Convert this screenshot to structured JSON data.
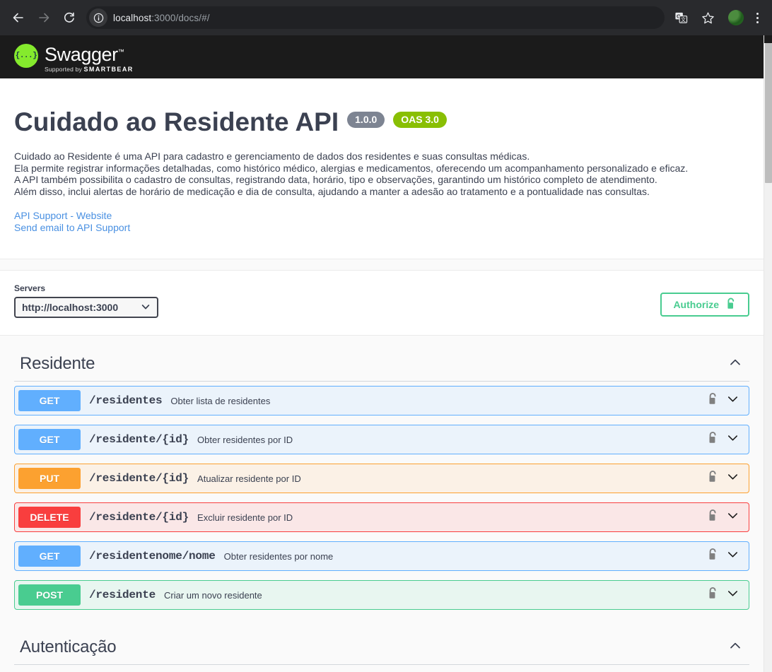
{
  "browser": {
    "back_icon": "arrow-left-icon",
    "forward_icon": "arrow-right-icon",
    "reload_icon": "reload-icon",
    "site_info_icon": "info-circle-icon",
    "url_host": "localhost",
    "url_path": ":3000/docs/#/",
    "url_full": "localhost:3000/docs/#/",
    "translate_icon": "translate-icon",
    "bookmark_icon": "star-icon",
    "profile_icon": "avatar",
    "menu_icon": "kebab-menu-icon"
  },
  "topbar": {
    "logo_glyph": "{...}",
    "logo_word": "Swagger",
    "logo_tm": "™",
    "supported_by_prefix": "Supported by",
    "supported_by_brand": "SMARTBEAR"
  },
  "info": {
    "title": "Cuidado ao Residente API",
    "version_badge": "1.0.0",
    "oas_badge": "OAS 3.0",
    "description_lines": [
      "Cuidado ao Residente é uma API para cadastro e gerenciamento de dados dos residentes e suas consultas médicas.",
      "Ela permite registrar informações detalhadas, como histórico médico, alergias e medicamentos, oferecendo um acompanhamento personalizado e eficaz.",
      "A API também possibilita o cadastro de consultas, registrando data, horário, tipo e observações, garantindo um histórico completo de atendimento.",
      "Além disso, inclui alertas de horário de medicação e dia de consulta, ajudando a manter a adesão ao tratamento e a pontualidade nas consultas."
    ],
    "links": [
      "API Support - Website",
      "Send email to API Support"
    ]
  },
  "scheme": {
    "servers_label": "Servers",
    "selected_server": "http://localhost:3000",
    "server_options": [
      "http://localhost:3000"
    ],
    "dropdown_icon": "chevron-down-icon",
    "authorize_label": "Authorize",
    "authorize_lock_icon": "unlocked-padlock-icon"
  },
  "colors": {
    "get": "#61affe",
    "put": "#fca130",
    "delete": "#f93e3e",
    "post": "#49cc90",
    "oas_badge": "#89bf04",
    "version_badge": "#7d8492",
    "authorize_green": "#49cc90",
    "link_blue": "#4990e2",
    "topbar_dark": "#1b1b1b",
    "swagger_green": "#85ea2d"
  },
  "tags": [
    {
      "name": "Residente",
      "collapse_icon": "chevron-up-icon",
      "operations": [
        {
          "verb": "GET",
          "path": "/residentes",
          "summary": "Obter lista de residentes",
          "lock_icon": "unlocked-padlock-icon",
          "expand_icon": "chevron-down-icon"
        },
        {
          "verb": "GET",
          "path": "/residente/{id}",
          "summary": "Obter residentes por ID",
          "lock_icon": "unlocked-padlock-icon",
          "expand_icon": "chevron-down-icon"
        },
        {
          "verb": "PUT",
          "path": "/residente/{id}",
          "summary": "Atualizar residente por ID",
          "lock_icon": "unlocked-padlock-icon",
          "expand_icon": "chevron-down-icon"
        },
        {
          "verb": "DELETE",
          "path": "/residente/{id}",
          "summary": "Excluir residente por ID",
          "lock_icon": "unlocked-padlock-icon",
          "expand_icon": "chevron-down-icon"
        },
        {
          "verb": "GET",
          "path": "/residentenome/nome",
          "summary": "Obter residentes por nome",
          "lock_icon": "unlocked-padlock-icon",
          "expand_icon": "chevron-down-icon"
        },
        {
          "verb": "POST",
          "path": "/residente",
          "summary": "Criar um novo residente",
          "lock_icon": "unlocked-padlock-icon",
          "expand_icon": "chevron-down-icon"
        }
      ]
    },
    {
      "name": "Autenticação",
      "collapse_icon": "chevron-up-icon",
      "operations": []
    }
  ]
}
